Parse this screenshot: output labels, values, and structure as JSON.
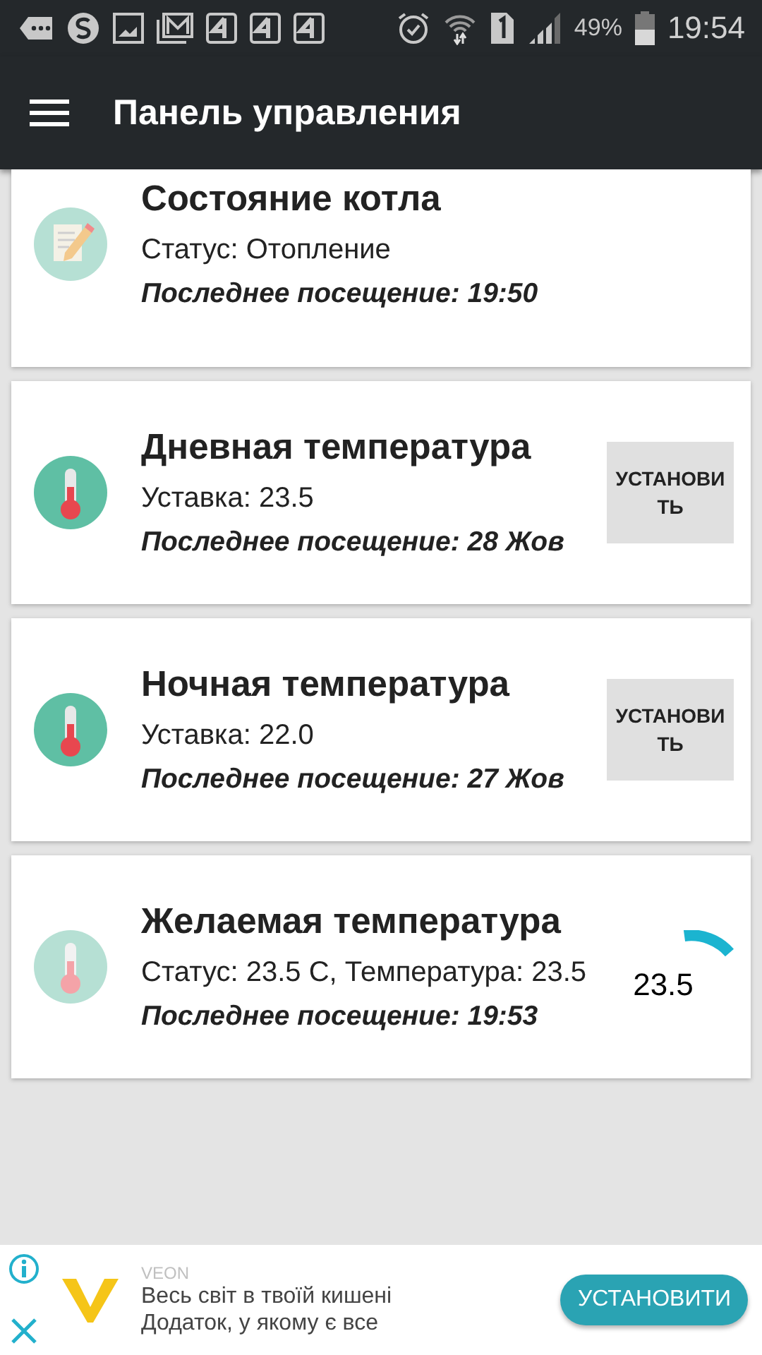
{
  "status_bar": {
    "battery_text": "49%",
    "time": "19:54"
  },
  "toolbar": {
    "title": "Панель управления"
  },
  "cards": [
    {
      "kind": "notepad",
      "title": "Состояние котла",
      "status": "Статус: Отопление",
      "last_visit": "Последнее посещение: 19:50"
    },
    {
      "kind": "thermometer",
      "title": "Дневная температура",
      "status": "Уставка: 23.5",
      "last_visit": "Последнее посещение: 28 Жов",
      "action": {
        "kind": "button",
        "label": "УСТАНОВИТЬ"
      }
    },
    {
      "kind": "thermometer",
      "title": "Ночная температура",
      "status": "Уставка: 22.0",
      "last_visit": "Последнее посещение: 27 Жов",
      "action": {
        "kind": "button",
        "label": "УСТАНОВИТЬ"
      }
    },
    {
      "kind": "thermometer-pale",
      "title": "Желаемая температура",
      "status": "Статус: 23.5 С, Температура: 23.5",
      "last_visit": "Последнее посещение: 19:53",
      "action": {
        "kind": "gauge",
        "reading": "23.5"
      }
    }
  ],
  "ad": {
    "brand": "VEON",
    "headline": "Весь світ в твоїй кишені",
    "subline": "Додаток, у якому є все",
    "button": "УСТАНОВИТИ"
  }
}
